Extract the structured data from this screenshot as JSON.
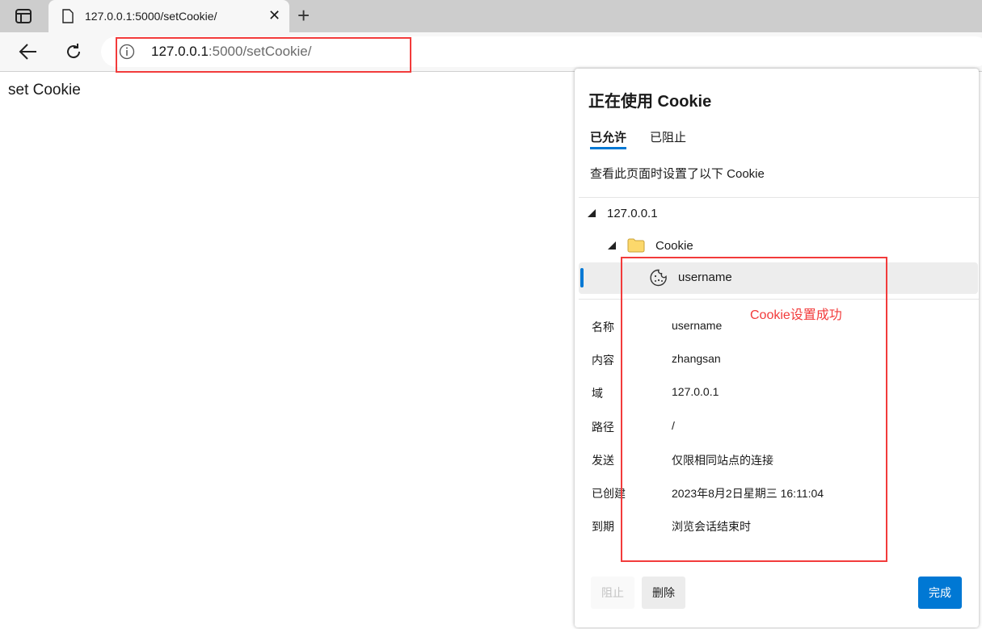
{
  "browser": {
    "tab_title": "127.0.0.1:5000/setCookie/",
    "url_host": "127.0.0.1",
    "url_rest": ":5000/setCookie/"
  },
  "page": {
    "text": "set Cookie"
  },
  "popup": {
    "title": "正在使用 Cookie",
    "tabs": [
      {
        "label": "已允许",
        "active": true
      },
      {
        "label": "已阻止",
        "active": false
      }
    ],
    "description": "查看此页面时设置了以下 Cookie",
    "tree": {
      "site": "127.0.0.1",
      "folder": "Cookie",
      "cookie": "username"
    },
    "details": [
      {
        "label": "名称",
        "value": "username"
      },
      {
        "label": "内容",
        "value": "zhangsan"
      },
      {
        "label": "域",
        "value": "127.0.0.1"
      },
      {
        "label": "路径",
        "value": "/"
      },
      {
        "label": "发送",
        "value": "仅限相同站点的连接"
      },
      {
        "label": "已创建",
        "value": "2023年8月2日星期三 16:11:04"
      },
      {
        "label": "到期",
        "value": "浏览会话结束时"
      }
    ],
    "buttons": {
      "block": "阻止",
      "delete": "删除",
      "done": "完成"
    }
  },
  "annotation": {
    "text": "Cookie设置成功",
    "color": "#f23b3b"
  },
  "colors": {
    "accent": "#0078d4",
    "folder": "#fcd86b"
  }
}
